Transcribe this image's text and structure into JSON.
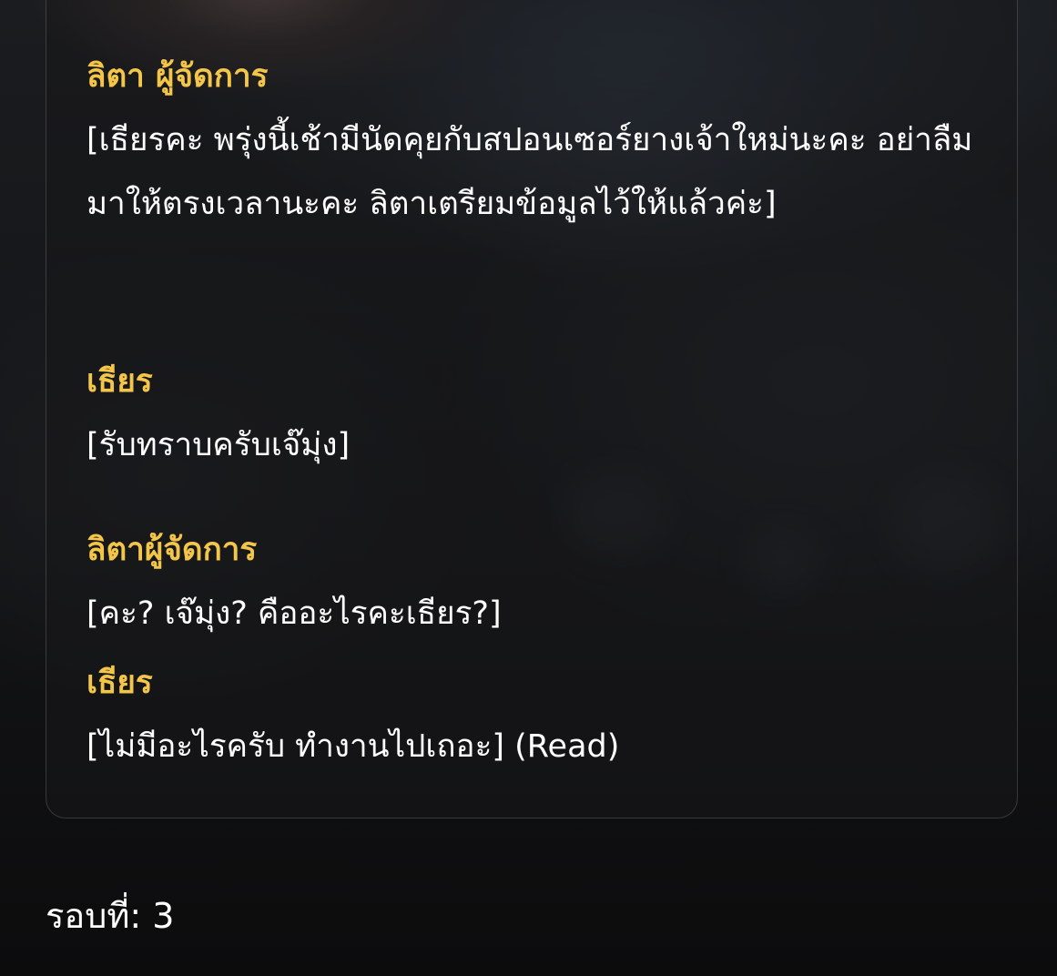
{
  "conversation": [
    {
      "speaker": "ลิตา ผู้จัดการ",
      "text": "[เธียรคะ พรุ่งนี้เช้ามีนัดคุยกับสปอนเซอร์ยางเจ้าใหม่นะคะ อย่าลืมมาให้ตรงเวลานะคะ ลิตาเตรียมข้อมูลไว้ให้แล้วค่ะ]"
    },
    {
      "speaker": "เธียร",
      "text": "[รับทราบครับเจ๊มุ่ง]"
    },
    {
      "speaker": "ลิตาผู้จัดการ",
      "text": "[คะ? เจ๊มุ่ง? คืออะไรคะเธียร?]"
    },
    {
      "speaker": "เธียร",
      "text": "[ไม่มีอะไรครับ ทำงานไปเถอะ] (Read)"
    }
  ],
  "round": {
    "label": "รอบที่: 3"
  },
  "colors": {
    "speaker": "#f3c64a",
    "text": "#ffffff",
    "card_border": "#3a3a3d"
  }
}
